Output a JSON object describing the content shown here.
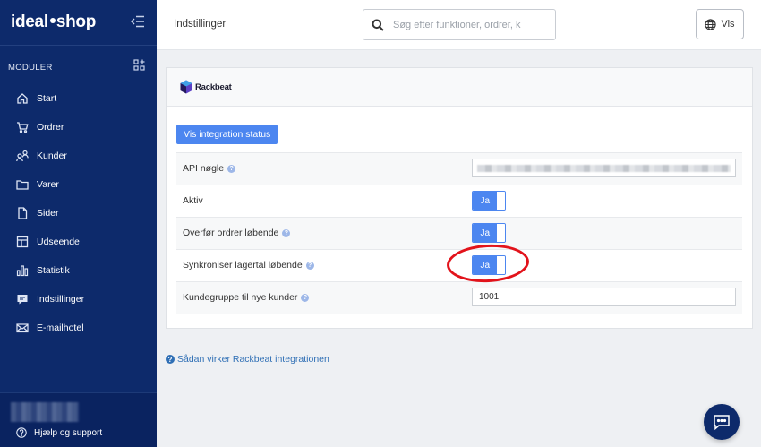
{
  "sidebar": {
    "brand_left": "ideal",
    "brand_right": "shop",
    "modules_label": "MODULER",
    "items": [
      {
        "label": "Start",
        "icon": "home-icon"
      },
      {
        "label": "Ordrer",
        "icon": "cart-icon"
      },
      {
        "label": "Kunder",
        "icon": "customers-icon"
      },
      {
        "label": "Varer",
        "icon": "folder-icon"
      },
      {
        "label": "Sider",
        "icon": "page-icon"
      },
      {
        "label": "Udseende",
        "icon": "layout-icon"
      },
      {
        "label": "Statistik",
        "icon": "chart-icon"
      },
      {
        "label": "Indstillinger",
        "icon": "settings-icon"
      },
      {
        "label": "E-mailhotel",
        "icon": "mail-icon"
      }
    ],
    "help_label": "Hjælp og support"
  },
  "header": {
    "title": "Indstillinger",
    "search_placeholder": "Søg efter funktioner, ordrer, k",
    "vis_label": "Vis"
  },
  "integration": {
    "logo_text": "Rackbeat",
    "status_button": "Vis integration status",
    "rows": {
      "api_key_label": "API nøgle",
      "active_label": "Aktiv",
      "active_value": "Ja",
      "transfer_orders_label": "Overfør ordrer løbende",
      "transfer_orders_value": "Ja",
      "sync_stock_label": "Synkroniser lagertal løbende",
      "sync_stock_value": "Ja",
      "customer_group_label": "Kundegruppe til nye kunder",
      "customer_group_value": "1001"
    },
    "help_link": "Sådan virker Rackbeat integrationen"
  },
  "colors": {
    "sidebar_bg": "#0d2a6b",
    "accent": "#4c86f0",
    "highlight": "#e2131b",
    "link": "#2f6fb5"
  }
}
